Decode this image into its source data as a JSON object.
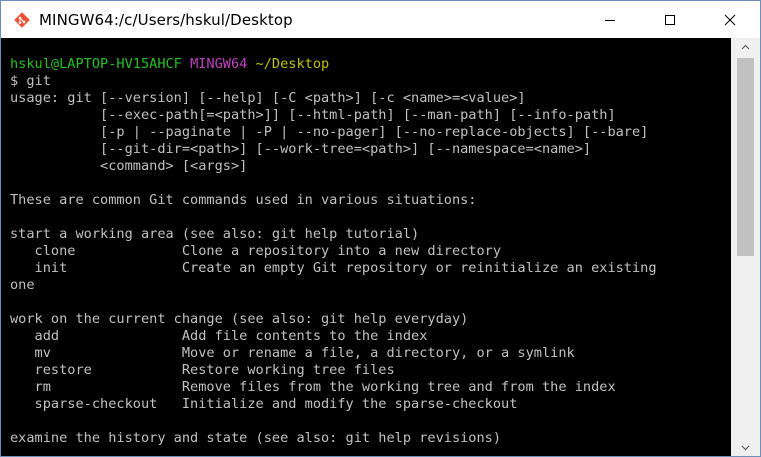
{
  "window": {
    "title": "MINGW64:/c/Users/hskul/Desktop",
    "icons": {
      "app": "git-bash-icon",
      "minimize": "minimize-icon",
      "maximize": "maximize-icon",
      "close": "close-icon"
    }
  },
  "prompt": {
    "user_host": "hskul@LAPTOP-HV15AHCF",
    "env": "MINGW64",
    "path": "~/Desktop",
    "symbol": "$",
    "command": "git"
  },
  "output": [
    "usage: git [--version] [--help] [-C <path>] [-c <name>=<value>]",
    "           [--exec-path[=<path>]] [--html-path] [--man-path] [--info-path]",
    "           [-p | --paginate | -P | --no-pager] [--no-replace-objects] [--bare]",
    "           [--git-dir=<path>] [--work-tree=<path>] [--namespace=<name>]",
    "           <command> [<args>]",
    "",
    "These are common Git commands used in various situations:",
    "",
    "start a working area (see also: git help tutorial)",
    "   clone             Clone a repository into a new directory",
    "   init              Create an empty Git repository or reinitialize an existing",
    "one",
    "",
    "work on the current change (see also: git help everyday)",
    "   add               Add file contents to the index",
    "   mv                Move or rename a file, a directory, or a symlink",
    "   restore           Restore working tree files",
    "   rm                Remove files from the working tree and from the index",
    "   sparse-checkout   Initialize and modify the sparse-checkout",
    "",
    "examine the history and state (see also: git help revisions)"
  ],
  "colors": {
    "background": "#000000",
    "text": "#c0c0c0",
    "user_host": "#26c026",
    "env": "#c040c0",
    "path": "#c0c000",
    "titlebar": "#ffffff",
    "scrollbar_track": "#f0f0f0",
    "scrollbar_thumb": "#c1c1c1"
  }
}
